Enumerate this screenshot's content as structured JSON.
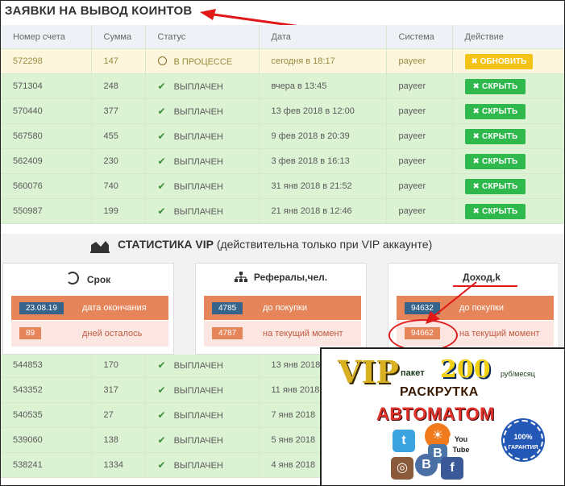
{
  "header": {
    "title": "ЗАЯВКИ НА ВЫВОД КОИНТОВ"
  },
  "table": {
    "columns": [
      "Номер счета",
      "Сумма",
      "Статус",
      "Дата",
      "Система",
      "Действие"
    ],
    "rows_top": [
      {
        "id": "572298",
        "sum": "147",
        "status": "В ПРОЦЕССЕ",
        "date": "сегодня в 18:17",
        "system": "payeer",
        "action": "✖ ОБНОВИТЬ",
        "state": "wait"
      },
      {
        "id": "571304",
        "sum": "248",
        "status": "ВЫПЛАЧЕН",
        "date": "вчера в 13:45",
        "system": "payeer",
        "action": "✖ СКРЫТЬ",
        "state": "ok"
      },
      {
        "id": "570440",
        "sum": "377",
        "status": "ВЫПЛАЧЕН",
        "date": "13 фев 2018 в 12:00",
        "system": "payeer",
        "action": "✖ СКРЫТЬ",
        "state": "ok"
      },
      {
        "id": "567580",
        "sum": "455",
        "status": "ВЫПЛАЧЕН",
        "date": "9 фев 2018 в 20:39",
        "system": "payeer",
        "action": "✖ СКРЫТЬ",
        "state": "ok"
      },
      {
        "id": "562409",
        "sum": "230",
        "status": "ВЫПЛАЧЕН",
        "date": "3 фев 2018 в 16:13",
        "system": "payeer",
        "action": "✖ СКРЫТЬ",
        "state": "ok"
      },
      {
        "id": "560076",
        "sum": "740",
        "status": "ВЫПЛАЧЕН",
        "date": "31 янв 2018 в 21:52",
        "system": "payeer",
        "action": "✖ СКРЫТЬ",
        "state": "ok"
      },
      {
        "id": "550987",
        "sum": "199",
        "status": "ВЫПЛАЧЕН",
        "date": "21 янв 2018 в 12:46",
        "system": "payeer",
        "action": "✖ СКРЫТЬ",
        "state": "ok"
      }
    ],
    "rows_bottom": [
      {
        "id": "544853",
        "sum": "170",
        "status": "ВЫПЛАЧЕН",
        "date": "13 янв 2018"
      },
      {
        "id": "543352",
        "sum": "317",
        "status": "ВЫПЛАЧЕН",
        "date": "11 янв 2018"
      },
      {
        "id": "540535",
        "sum": "27",
        "status": "ВЫПЛАЧЕН",
        "date": "7 янв 2018"
      },
      {
        "id": "539060",
        "sum": "138",
        "status": "ВЫПЛАЧЕН",
        "date": "5 янв 2018"
      },
      {
        "id": "538241",
        "sum": "1334",
        "status": "ВЫПЛАЧЕН",
        "date": "4 янв 2018"
      }
    ]
  },
  "stats": {
    "title_bold": "СТАТИСТИКА VIP",
    "title_rest": " (действительна только при VIP аккаунте)",
    "cards": [
      {
        "title": "Срок",
        "v1": "23.08.19",
        "l1": "дата окончания",
        "v2": "89",
        "l2": "дней осталось"
      },
      {
        "title": "Рефералы,чел.",
        "v1": "4785",
        "l1": "до покупки",
        "v2": "4787",
        "l2": "на текущий момент"
      },
      {
        "title": "Доход,k",
        "v1": "94632",
        "l1": "до покупки",
        "v2": "94662",
        "l2": "на текущий момент"
      }
    ]
  },
  "ad": {
    "vip": "VIP",
    "paket": "пакет",
    "amount": "200",
    "per_month": "руб/месяц",
    "line2": "РАСКРУТКА",
    "line3": "АВТОМАТОМ",
    "seal_pct": "100%",
    "seal_text": "ГАРАНТИЯ",
    "youtube": "You Tube"
  },
  "colors": {
    "paid_row": "#dbf2d3",
    "pending_row": "#fcf7dc",
    "hide_button": "#2fb84c",
    "refresh_button": "#f3c316",
    "value_badge": "#36638a",
    "accent_orange": "#e6855a"
  }
}
